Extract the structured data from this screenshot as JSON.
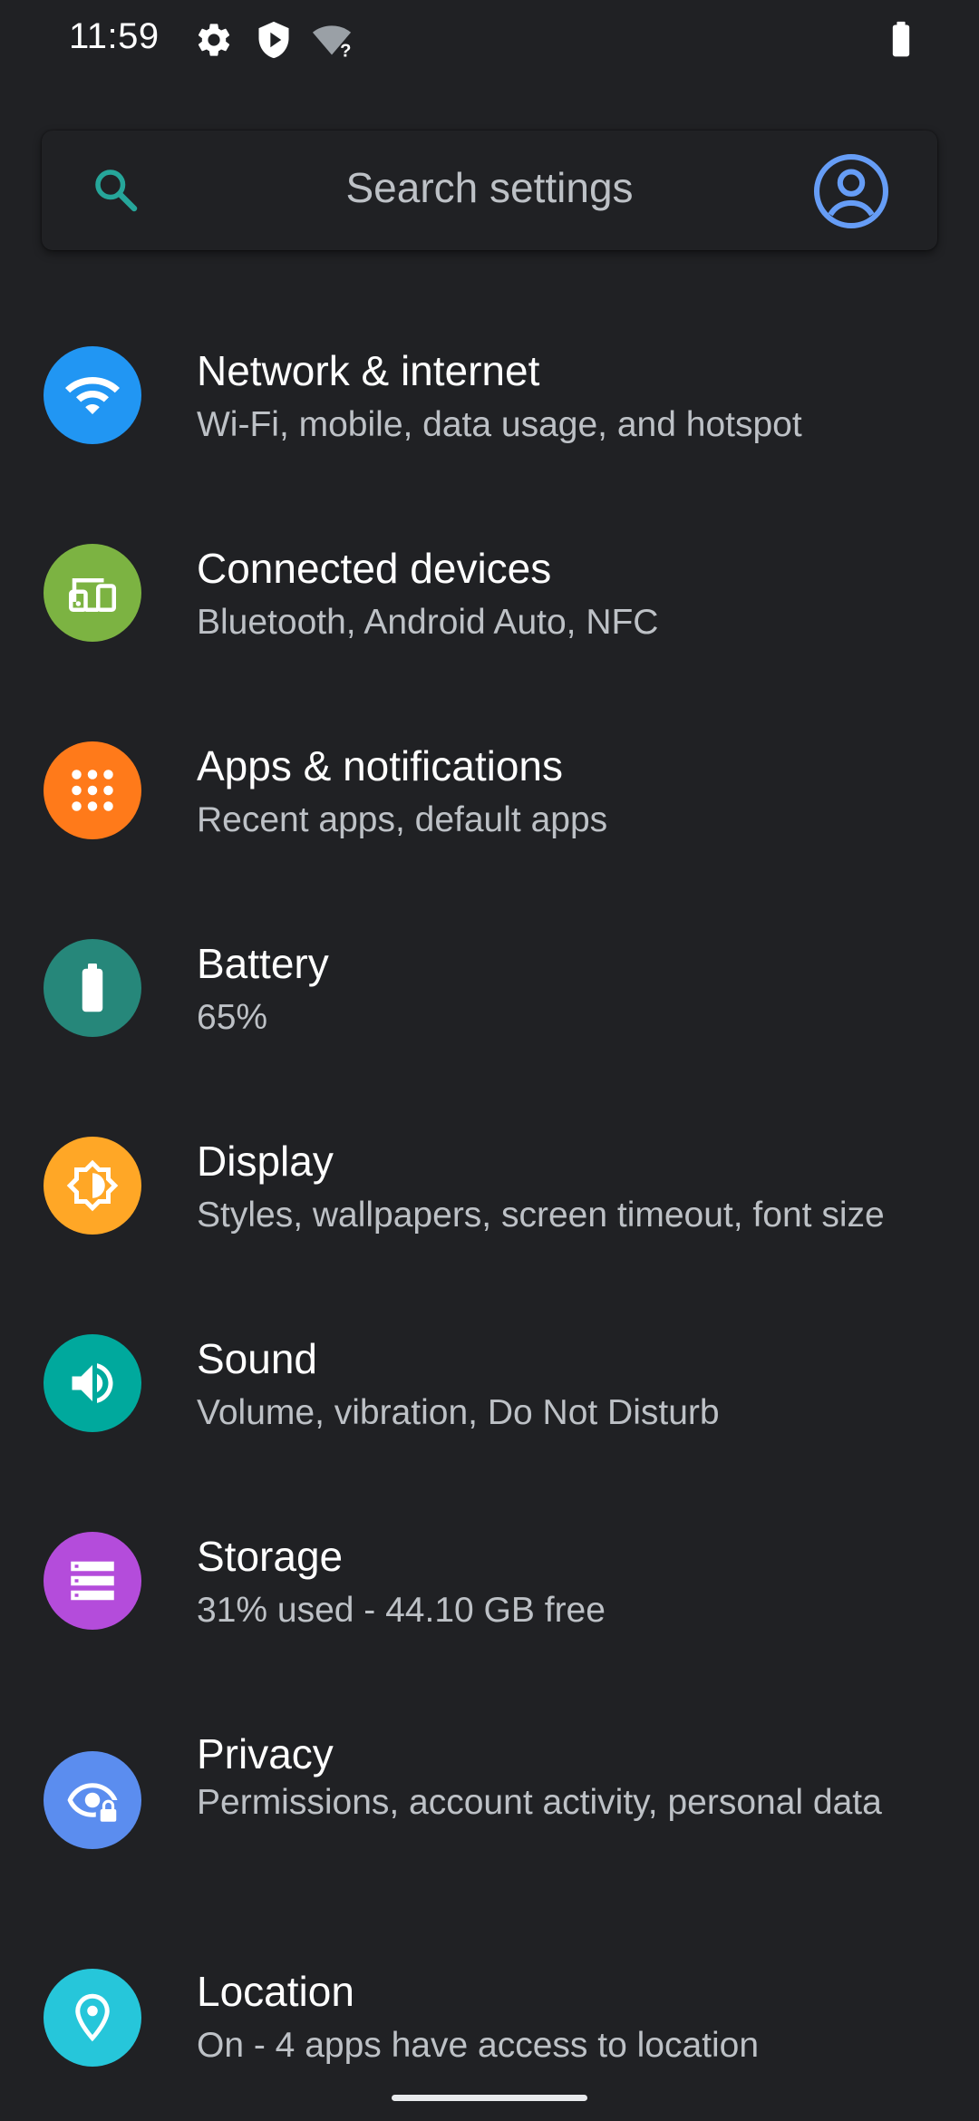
{
  "status_bar": {
    "time": "11:59",
    "icons": [
      "gear-icon",
      "play-shield-icon",
      "wifi-unknown-icon",
      "battery-icon"
    ],
    "wifi_unknown_mark": "?"
  },
  "search": {
    "placeholder": "Search settings",
    "accent_color": "#26a69a",
    "account_color": "#669df6"
  },
  "settings": [
    {
      "title": "Network & internet",
      "subtitle": "Wi-Fi, mobile, data usage, and hotspot",
      "icon": "wifi-icon",
      "color": "#2196f3"
    },
    {
      "title": "Connected devices",
      "subtitle": "Bluetooth, Android Auto, NFC",
      "icon": "devices-icon",
      "color": "#7cb342"
    },
    {
      "title": "Apps & notifications",
      "subtitle": "Recent apps, default apps",
      "icon": "apps-icon",
      "color": "#ff7a1a"
    },
    {
      "title": "Battery",
      "subtitle": "65%",
      "icon": "battery-icon",
      "color": "#26877a"
    },
    {
      "title": "Display",
      "subtitle": "Styles, wallpapers, screen timeout, font size",
      "icon": "brightness-icon",
      "color": "#ffa726"
    },
    {
      "title": "Sound",
      "subtitle": "Volume, vibration, Do Not Disturb",
      "icon": "volume-icon",
      "color": "#00a99d"
    },
    {
      "title": "Storage",
      "subtitle": "31% used - 44.10 GB free",
      "icon": "storage-icon",
      "color": "#b44cdb"
    },
    {
      "title": "Privacy",
      "subtitle": "Permissions, account activity, personal data",
      "icon": "privacy-icon",
      "color": "#5b8def"
    },
    {
      "title": "Location",
      "subtitle": "On - 4 apps have access to location",
      "icon": "location-icon",
      "color": "#26c6da"
    }
  ]
}
